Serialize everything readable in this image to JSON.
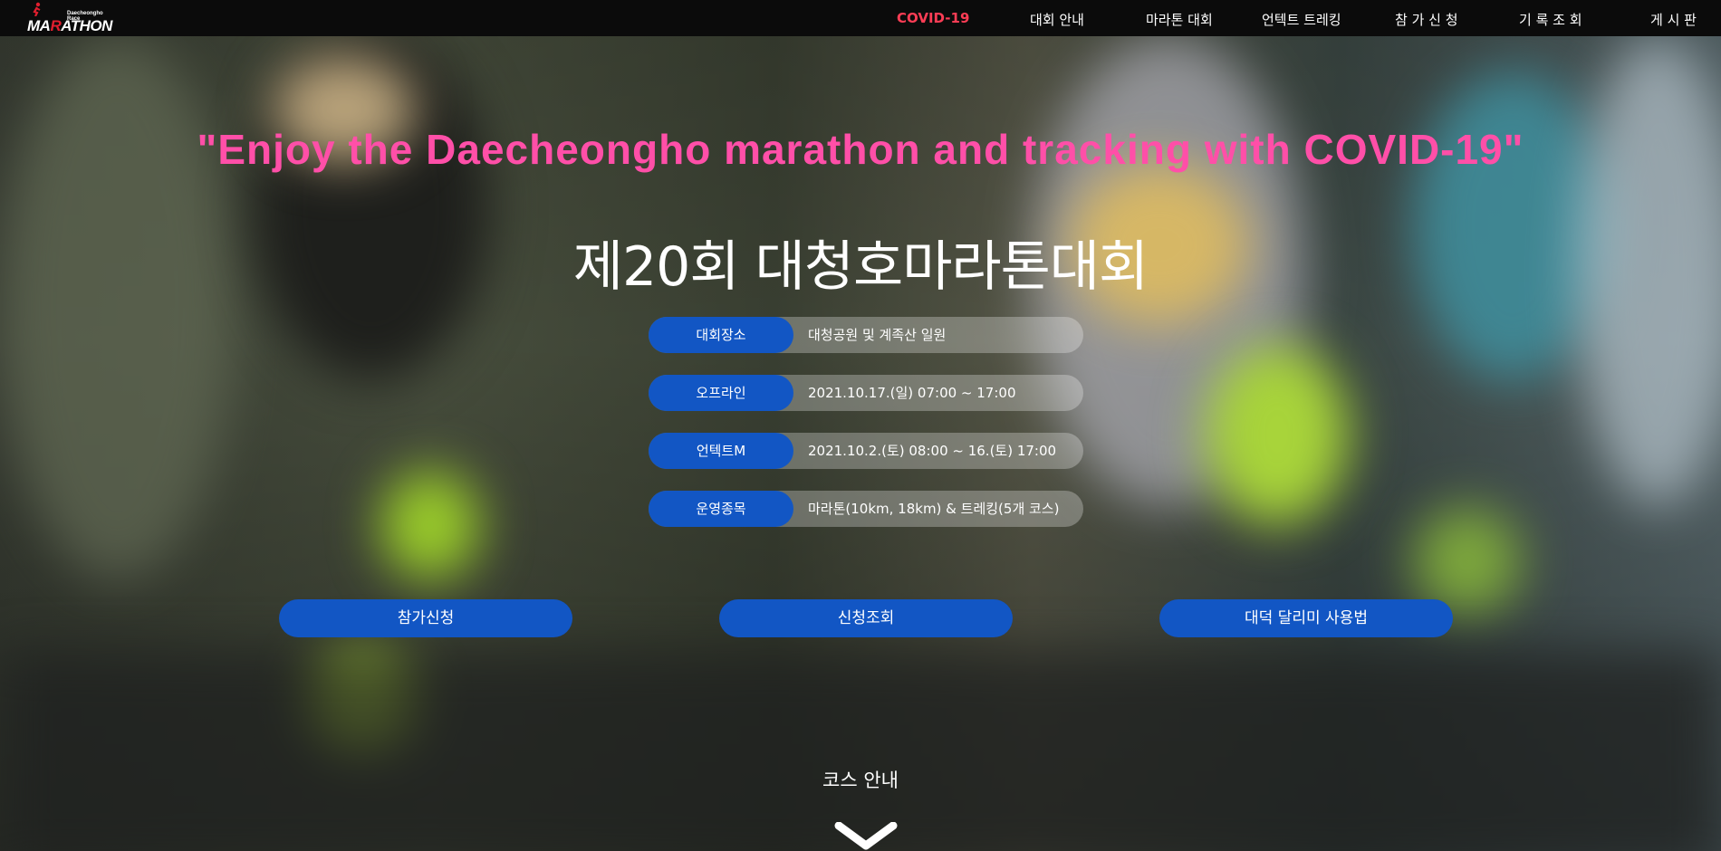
{
  "nav": {
    "logo": {
      "small_text": "Daecheongho Race",
      "main_text_prefix": "MA",
      "main_text_r": "R",
      "main_text_suffix": "ATHON"
    },
    "items": [
      {
        "label": "COVID-19",
        "active": true
      },
      {
        "label": "대회 안내"
      },
      {
        "label": "마라톤 대회"
      },
      {
        "label": "언텍트 트레킹"
      },
      {
        "label": "참 가 신 청"
      },
      {
        "label": "기 록 조 회"
      },
      {
        "label": "게 시 판"
      }
    ]
  },
  "hero": {
    "slogan": "\"Enjoy the Daecheongho marathon and tracking with COVID-19\"",
    "title": "제20회 대청호마라톤대회"
  },
  "info": [
    {
      "label": "대회장소",
      "value": "대청공원 및 계족산 일원"
    },
    {
      "label": "오프라인",
      "value": "2021.10.17.(일) 07:00 ~ 17:00"
    },
    {
      "label": "언텍트M",
      "value": "2021.10.2.(토) 08:00 ~ 16.(토) 17:00"
    },
    {
      "label": "운영종목",
      "value": "마라톤(10km, 18km) & 트레킹(5개 코스)"
    }
  ],
  "buttons": {
    "apply": "참가신청",
    "check": "신청조회",
    "guide": "대덕 달리미 사용법"
  },
  "course": {
    "label": "코스 안내"
  },
  "colors": {
    "nav_bg": "#0b0b0b",
    "nav_active": "#ff3d55",
    "slogan": "#ff4fa8",
    "accent_blue": "#1256c4",
    "logo_red": "#e01e2e"
  },
  "icons": {
    "scroll_down": "chevron-down-icon",
    "logo_runner": "runner-icon"
  }
}
